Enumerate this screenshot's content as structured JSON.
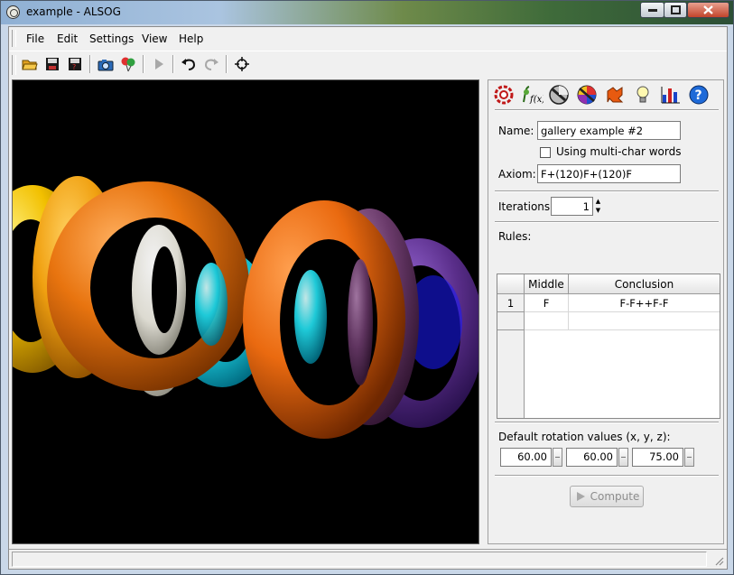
{
  "window": {
    "title": "example - ALSOG"
  },
  "menu": {
    "items": [
      {
        "label": "File"
      },
      {
        "label": "Edit"
      },
      {
        "label": "Settings"
      },
      {
        "label": "View"
      },
      {
        "label": "Help"
      }
    ]
  },
  "toolbar": {
    "icons": [
      "open-folder-icon",
      "save-icon",
      "save-as-icon",
      "camera-icon",
      "balloons-icon",
      "play-icon",
      "undo-icon",
      "redo-icon",
      "crosshair-icon"
    ]
  },
  "panel": {
    "tabs": [
      "lsystem-tab-icon",
      "functions-tab-icon",
      "shape-tab-icon",
      "color-wheel-tab-icon",
      "texture-tab-icon",
      "light-bulb-tab-icon",
      "statistics-tab-icon",
      "help-tab-icon"
    ],
    "name_label": "Name:",
    "name_value": "gallery example #2",
    "multichar_label": "Using multi-char words",
    "axiom_label": "Axiom:",
    "axiom_value": "F+(120)F+(120)F",
    "iterations_label": "Iterations:",
    "iterations_value": "1",
    "rules_label": "Rules:",
    "rules_columns": [
      "Middle",
      "Conclusion"
    ],
    "rules_rows": [
      {
        "index": "1",
        "middle": "F",
        "conclusion": "F-F++F-F"
      }
    ],
    "rotation_label": "Default rotation values (x, y, z):",
    "rotation_x": "60.00",
    "rotation_y": "60.00",
    "rotation_z": "75.00",
    "compute_label": "Compute"
  },
  "colors": {
    "viewport_bg": "#000000",
    "torus_orange": "#e8740f",
    "torus_yellow": "#f2c800",
    "torus_cyan": "#22e0f0",
    "torus_purple": "#5a2e8a"
  }
}
